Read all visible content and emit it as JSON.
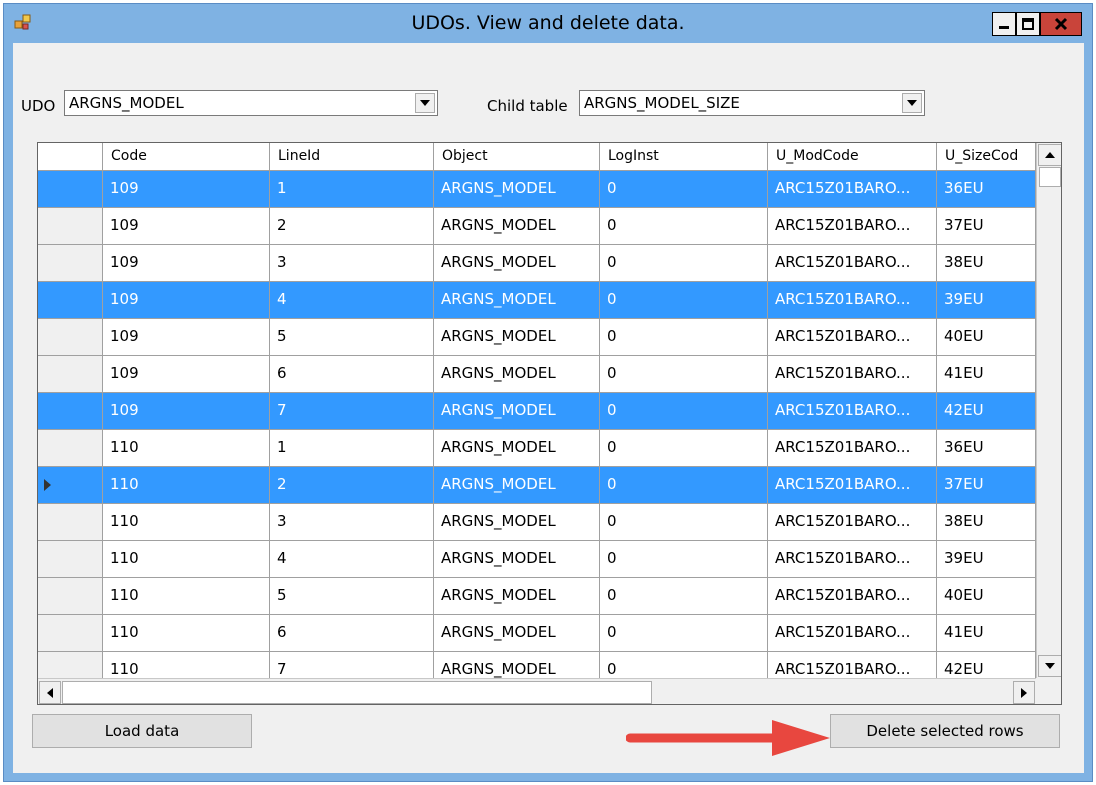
{
  "window": {
    "title": "UDOs. View and delete data."
  },
  "filters": {
    "udo_label": "UDO",
    "udo_value": "ARGNS_MODEL",
    "child_label": "Child table",
    "child_value": "ARGNS_MODEL_SIZE"
  },
  "grid": {
    "columns": [
      "Code",
      "LineId",
      "Object",
      "LogInst",
      "U_ModCode",
      "U_SizeCod"
    ],
    "rows": [
      {
        "selected": true,
        "cells": [
          "109",
          "1",
          "ARGNS_MODEL",
          "0",
          "ARC15Z01BARO...",
          "36EU"
        ]
      },
      {
        "selected": false,
        "cells": [
          "109",
          "2",
          "ARGNS_MODEL",
          "0",
          "ARC15Z01BARO...",
          "37EU"
        ]
      },
      {
        "selected": false,
        "cells": [
          "109",
          "3",
          "ARGNS_MODEL",
          "0",
          "ARC15Z01BARO...",
          "38EU"
        ]
      },
      {
        "selected": true,
        "cells": [
          "109",
          "4",
          "ARGNS_MODEL",
          "0",
          "ARC15Z01BARO...",
          "39EU"
        ]
      },
      {
        "selected": false,
        "cells": [
          "109",
          "5",
          "ARGNS_MODEL",
          "0",
          "ARC15Z01BARO...",
          "40EU"
        ]
      },
      {
        "selected": false,
        "cells": [
          "109",
          "6",
          "ARGNS_MODEL",
          "0",
          "ARC15Z01BARO...",
          "41EU"
        ]
      },
      {
        "selected": true,
        "cells": [
          "109",
          "7",
          "ARGNS_MODEL",
          "0",
          "ARC15Z01BARO...",
          "42EU"
        ]
      },
      {
        "selected": false,
        "cells": [
          "110",
          "1",
          "ARGNS_MODEL",
          "0",
          "ARC15Z01BARO...",
          "36EU"
        ]
      },
      {
        "selected": true,
        "current": true,
        "cells": [
          "110",
          "2",
          "ARGNS_MODEL",
          "0",
          "ARC15Z01BARO...",
          "37EU"
        ]
      },
      {
        "selected": false,
        "cells": [
          "110",
          "3",
          "ARGNS_MODEL",
          "0",
          "ARC15Z01BARO...",
          "38EU"
        ]
      },
      {
        "selected": false,
        "cells": [
          "110",
          "4",
          "ARGNS_MODEL",
          "0",
          "ARC15Z01BARO...",
          "39EU"
        ]
      },
      {
        "selected": false,
        "cells": [
          "110",
          "5",
          "ARGNS_MODEL",
          "0",
          "ARC15Z01BARO...",
          "40EU"
        ]
      },
      {
        "selected": false,
        "cells": [
          "110",
          "6",
          "ARGNS_MODEL",
          "0",
          "ARC15Z01BARO...",
          "41EU"
        ]
      },
      {
        "selected": false,
        "cells": [
          "110",
          "7",
          "ARGNS_MODEL",
          "0",
          "ARC15Z01BARO...",
          "42EU"
        ]
      }
    ]
  },
  "buttons": {
    "load_label": "Load data",
    "delete_label": "Delete selected rows"
  },
  "colors": {
    "selection": "#3399ff",
    "titlebar": "#7fb2e3",
    "close_button": "#c9443a",
    "annotation_arrow": "#e8473f"
  },
  "icons": [
    "app-icon",
    "minimize-icon",
    "maximize-icon",
    "close-icon",
    "dropdown-arrow-icon",
    "scroll-up-icon",
    "scroll-down-icon",
    "scroll-left-icon",
    "scroll-right-icon",
    "current-row-icon"
  ]
}
